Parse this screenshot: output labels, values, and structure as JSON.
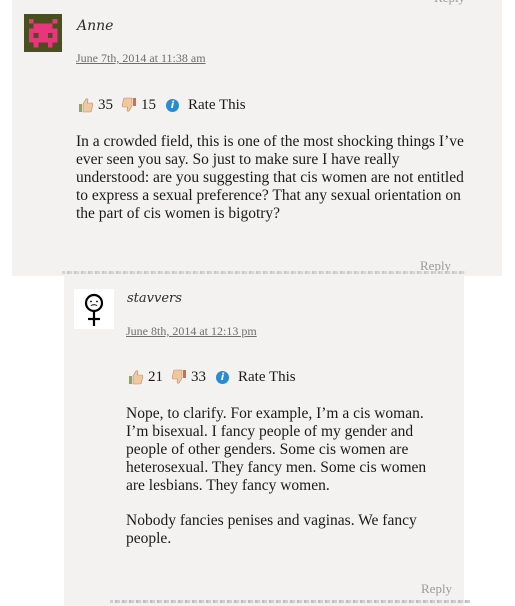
{
  "comments": [
    {
      "author": "Anne",
      "date": "June 7th, 2014 at 11:38 am",
      "likes": "35",
      "dislikes": "15",
      "rate_label": "Rate This",
      "paragraphs": [
        "In a crowded field, this is one of the most shocking things I’ve ever seen you say. So just to make sure I have really understood: are you suggesting that cis women are not entitled to express a sexual preference? That any sexual orientation on the part of cis women is bigotry?"
      ],
      "reply_label": "Reply"
    },
    {
      "author": "stavvers",
      "date": "June 8th, 2014 at 12:13 pm",
      "likes": "21",
      "dislikes": "33",
      "rate_label": "Rate This",
      "paragraphs": [
        "Nope, to clarify. For example, I’m a cis woman. I’m bisexual. I fancy people of my gender and people of other genders. Some cis women are heterosexual. They fancy men. Some cis women are lesbians. They fancy women.",
        "Nobody fancies penises and vaginas. We fancy people."
      ],
      "reply_label": "Reply"
    }
  ],
  "colors": {
    "info_icon": "#2a8bd0",
    "avatar_anne_bg": "#4a4f1f",
    "avatar_anne_fg": "#e8357c"
  }
}
